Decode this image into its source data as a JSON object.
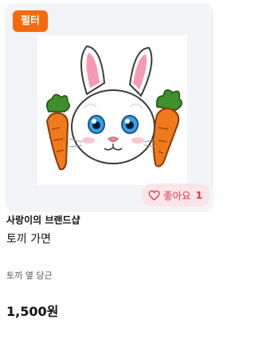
{
  "product": {
    "badge": "펄터",
    "image_alt": "rabbit-mask",
    "likes": {
      "label": "좋아요",
      "count": "1",
      "accent": "#e5394f",
      "background": "#fbe5e8"
    },
    "brand": "사랑이의 브랜드샵",
    "name": "토끼 가면",
    "option": "토끼 옆 당근",
    "price": "1,500원"
  },
  "colors": {
    "badge_bg": "#f66a0c",
    "thumb_bg": "#f3f4f7"
  }
}
